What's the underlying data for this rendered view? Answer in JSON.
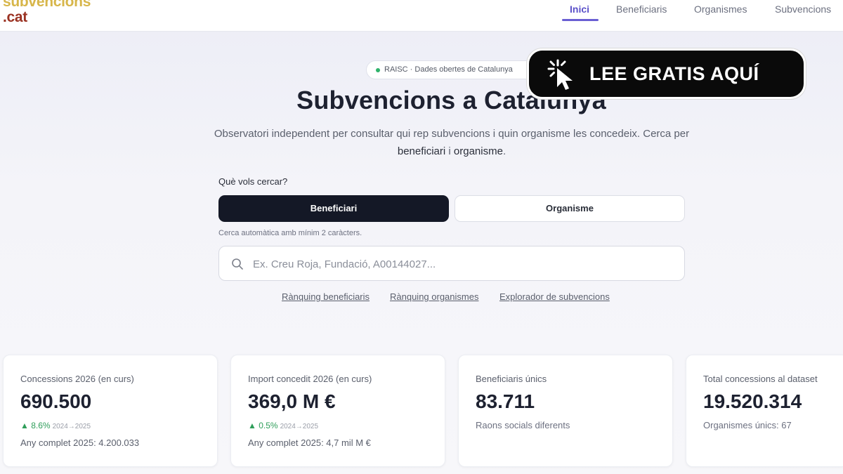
{
  "logo": {
    "line1": "subvencions",
    "line2": ".cat"
  },
  "nav": [
    {
      "label": "Inici"
    },
    {
      "label": "Beneficiaris"
    },
    {
      "label": "Organismes"
    },
    {
      "label": "Subvencions"
    }
  ],
  "hero": {
    "pill": "RAISC · Dades obertes de Catalunya",
    "title": "Subvencions a Catalunya",
    "subtitle_pre": "Observatori independent per consultar qui rep subvencions i quin organisme les concedeix. Cerca per",
    "subtitle_b1": "beneficiari",
    "subtitle_mid": " i ",
    "subtitle_b2": "organisme",
    "subtitle_end": "."
  },
  "cta": {
    "label": "LEE GRATIS AQUÍ"
  },
  "search": {
    "question": "Què vols cercar?",
    "option_active": "Beneficiari",
    "option_inactive": "Organisme",
    "hint": "Cerca automàtica amb mínim 2 caràcters.",
    "placeholder": "Ex. Creu Roja, Fundació, A00144027...",
    "links": [
      "Rànquing beneficiaris",
      "Rànquing organismes",
      "Explorador de subvencions"
    ]
  },
  "stats": [
    {
      "label": "Concessions 2026 (en curs)",
      "value": "690.500",
      "delta": "▲ 8.6%",
      "delta_period": "2024→2025",
      "sub": "Any complet 2025: 4.200.033"
    },
    {
      "label": "Import concedit 2026 (en curs)",
      "value": "369,0 M €",
      "delta": "▲ 0.5%",
      "delta_period": "2024→2025",
      "sub": "Any complet 2025: 4,7 mil M €"
    },
    {
      "label": "Beneficiaris únics",
      "value": "83.711",
      "sub": "Raons socials diferents"
    },
    {
      "label": "Total concessions al dataset",
      "value": "19.520.314",
      "sub": "Organismes únics: 67"
    }
  ],
  "colors": {
    "accent": "#5b51c9",
    "dark": "#141826",
    "positive": "#2f9e5a"
  }
}
